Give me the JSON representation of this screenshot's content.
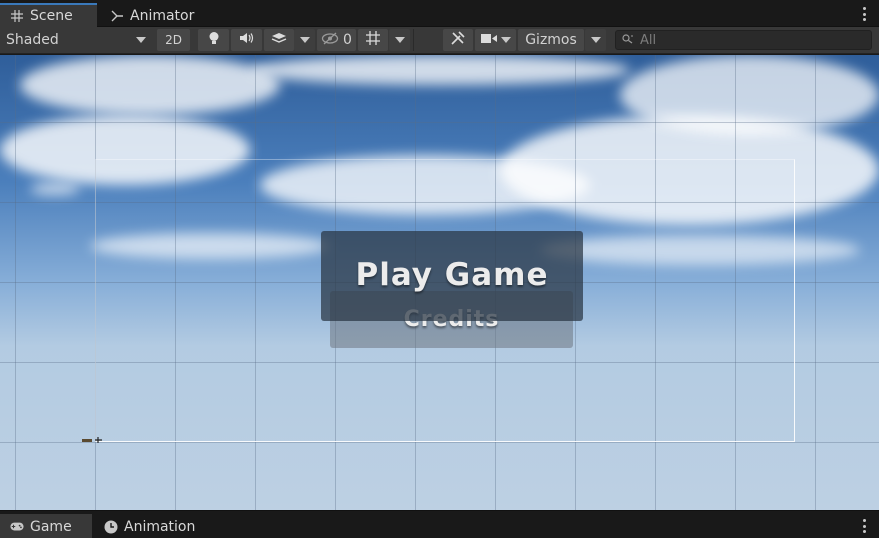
{
  "tabs_top": [
    {
      "label": "Scene",
      "icon": "grid-icon",
      "active": true
    },
    {
      "label": "Animator",
      "icon": "animator-icon",
      "active": false
    }
  ],
  "toolbar": {
    "draw_mode": "Shaded",
    "toggle_2d": "2D",
    "hidden_count": "0",
    "gizmos_label": "Gizmos",
    "search_placeholder": "All"
  },
  "scene": {
    "play_button_text": "Play Game",
    "credits_button_text": "Credits"
  },
  "tabs_bottom": [
    {
      "label": "Game",
      "icon": "gamepad-icon",
      "active": true
    },
    {
      "label": "Animation",
      "icon": "clock-icon",
      "active": false
    }
  ],
  "colors": {
    "accent": "#3a79bb",
    "panel": "#383838",
    "tab_background": "#191919"
  }
}
